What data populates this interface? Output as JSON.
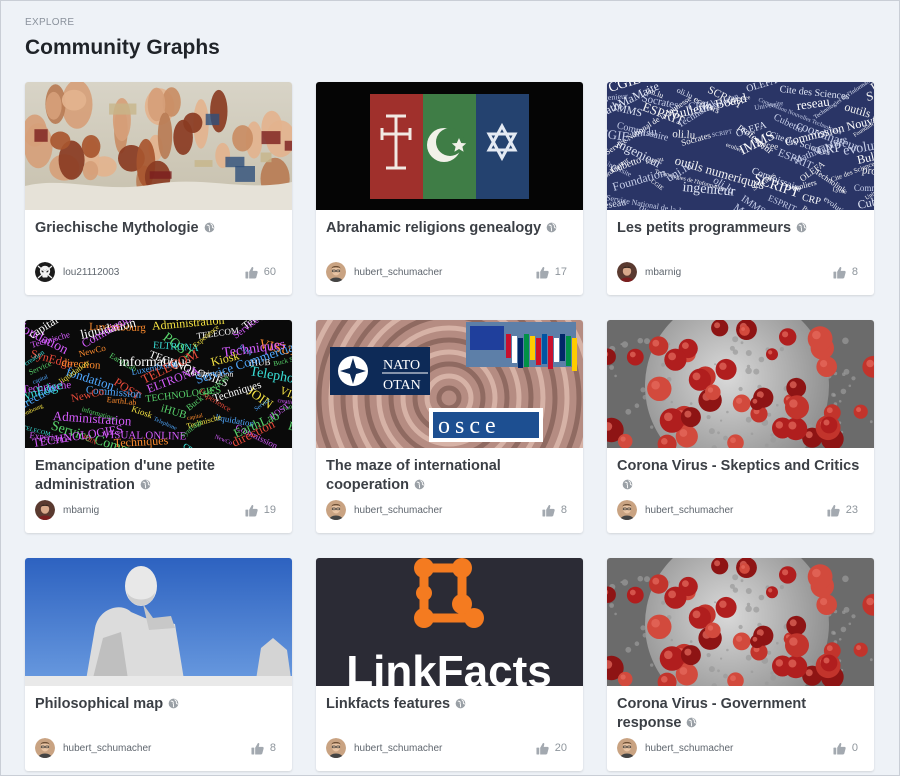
{
  "header": {
    "eyebrow": "EXPLORE",
    "title": "Community Graphs"
  },
  "colors": {
    "background": "#eef2f7",
    "card": "#ffffff",
    "title_text": "#3b3f45",
    "muted": "#8e959c"
  },
  "cards": [
    {
      "title": "Griechische Mythologie",
      "user": "lou21112003",
      "likes": "60",
      "image": "renaissance-fresco-gods",
      "avatar": "skull-avatar"
    },
    {
      "title": "Abrahamic religions genealogy",
      "user": "hubert_schumacher",
      "likes": "17",
      "image": "three-religion-flags",
      "avatar": "hubert-avatar"
    },
    {
      "title": "Les petits programmeurs",
      "user": "mbarnig",
      "likes": "8",
      "image": "word-cloud-blue",
      "avatar": "mbarnig-avatar"
    },
    {
      "title": "Emancipation d'une petite administration",
      "user": "mbarnig",
      "likes": "19",
      "image": "word-cloud-colorful",
      "avatar": "mbarnig-avatar"
    },
    {
      "title": "The maze of international cooperation",
      "user": "hubert_schumacher",
      "likes": "8",
      "image": "maze-nato-osce",
      "avatar": "hubert-avatar",
      "image_text": {
        "nato": "NATO",
        "otan": "OTAN",
        "osce": "osce"
      }
    },
    {
      "title": "Corona Virus - Skeptics and Critics",
      "user": "hubert_schumacher",
      "likes": "23",
      "image": "coronavirus",
      "avatar": "hubert-avatar"
    },
    {
      "title": "Philosophical map",
      "user": "hubert_schumacher",
      "likes": "8",
      "image": "philosopher-statue",
      "avatar": "hubert-avatar"
    },
    {
      "title": "Linkfacts features",
      "user": "hubert_schumacher",
      "likes": "20",
      "image": "linkfacts-logo",
      "avatar": "hubert-avatar",
      "image_text": {
        "logo": "LinkFacts"
      }
    },
    {
      "title": "Corona Virus - Government response",
      "user": "hubert_schumacher",
      "likes": "0",
      "image": "coronavirus",
      "avatar": "hubert-avatar"
    }
  ],
  "wordclouds": {
    "blue": [
      "CGIE",
      "uni.lu",
      "oli.lu",
      "SCRIPT",
      "OLEFA",
      "Cite des Sciences",
      "Foundation",
      "ingenieur",
      "Socrates",
      "ecoliers",
      "Lycee",
      "Commission Nouvelles Technologies",
      "Service National de la Jeunesse",
      "IMMS",
      "ESPRIT",
      "CRP",
      "evolution",
      "Universite",
      "reseau",
      "outils numeriques",
      "MathMaMaite",
      "Bulletin Board",
      "Cubetto",
      "Technologies de l'Information",
      "Commissaire",
      "Technolink",
      "professeur",
      "coordinateur"
    ],
    "colorful": [
      "fondation",
      "Luxembourg",
      "Administration",
      "Telephone",
      "capital",
      "liquidation",
      "POST",
      "TELECOM",
      "Service Commercial",
      "Technische",
      "Commission",
      "ELTRONA",
      "Experience",
      "JOIN",
      "VISUAL ONLINE",
      "SynEdge",
      "NewCo",
      "EarthLab",
      "TECHNOLOGIES",
      "Techniques",
      "creation",
      "direction",
      "informatique",
      "Kiosk",
      "iHUB",
      "Buck Services",
      "Service"
    ]
  }
}
